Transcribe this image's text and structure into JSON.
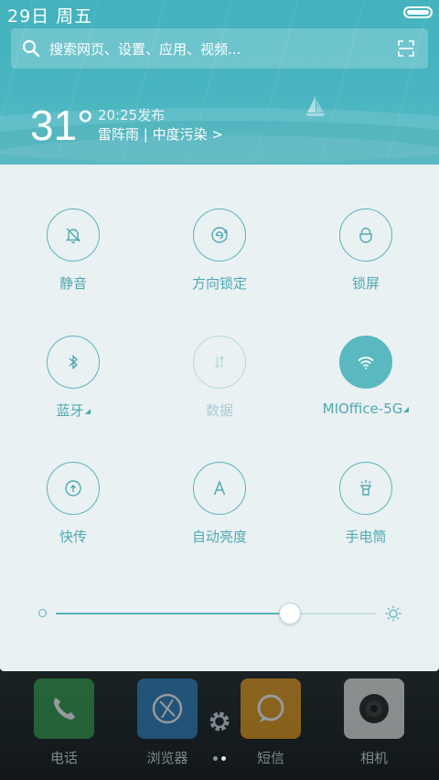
{
  "status": {
    "date": "29日  周五"
  },
  "search": {
    "placeholder": "搜索网页、设置、应用、视频..."
  },
  "weather": {
    "temperature": "31°",
    "published": "20:25发布",
    "condition": "雷阵雨 | 中度污染 >"
  },
  "toggles": [
    {
      "label": "静音",
      "icon": "bell-off-icon",
      "state": "off"
    },
    {
      "label": "方向锁定",
      "icon": "rotation-lock-icon",
      "state": "off"
    },
    {
      "label": "锁屏",
      "icon": "lock-icon",
      "state": "off"
    },
    {
      "label": "蓝牙",
      "icon": "bluetooth-icon",
      "state": "off"
    },
    {
      "label": "数据",
      "icon": "data-arrows-icon",
      "state": "disabled"
    },
    {
      "label": "MIOffice-5G",
      "icon": "wifi-icon",
      "state": "on"
    },
    {
      "label": "快传",
      "icon": "share-up-icon",
      "state": "off"
    },
    {
      "label": "自动亮度",
      "icon": "auto-a-icon",
      "state": "off"
    },
    {
      "label": "手电筒",
      "icon": "flashlight-icon",
      "state": "off"
    }
  ],
  "brightness": {
    "level": 0.73
  },
  "dock": {
    "apps": [
      {
        "label": "电话",
        "color": "#2f9b4a"
      },
      {
        "label": "浏览器",
        "color": "#2b7fc0"
      },
      {
        "label": "短信",
        "color": "#e69a1c"
      },
      {
        "label": "相机",
        "color": "#e8e8e8"
      }
    ],
    "page_count": 2,
    "current_page": 1
  },
  "colors": {
    "accent": "#5ab8c1",
    "header": "#48b5c0",
    "panel": "#eaf1f3"
  }
}
